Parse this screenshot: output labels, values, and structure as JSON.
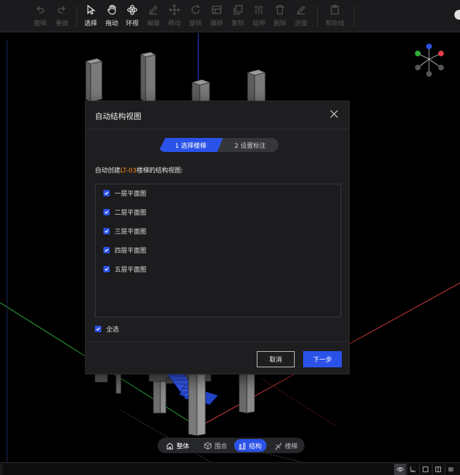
{
  "toolbar": {
    "undo": "撤销",
    "redo": "重做",
    "select": "选择",
    "drag": "拖动",
    "orbit": "环视",
    "edit": "编辑",
    "move": "移动",
    "rotate": "旋转",
    "shift": "偏移",
    "copy": "复制",
    "extend": "延伸",
    "delete": "删除",
    "measure": "测量",
    "help": "帮助线"
  },
  "dialog": {
    "title": "自动结构视图",
    "step1": "1 选择楼梯",
    "step2": "2 设置标注",
    "prompt_prefix": "自动创建",
    "prompt_highlight": "LT-03",
    "prompt_suffix": "楼梯的结构视图:",
    "items": [
      {
        "label": "一层平面图",
        "checked": true
      },
      {
        "label": "二层平面图",
        "checked": true
      },
      {
        "label": "三层平面图",
        "checked": true
      },
      {
        "label": "四层平面图",
        "checked": true
      },
      {
        "label": "五层平面图",
        "checked": true
      }
    ],
    "select_all": "全选",
    "cancel": "取消",
    "next": "下一步"
  },
  "modes": {
    "whole": "整体",
    "enclose": "围合",
    "structure": "结构",
    "stairs": "楼梯",
    "active": "structure"
  },
  "colors": {
    "accent": "#2b52e8",
    "highlight": "#ff8a1c",
    "axis_x": "#d23a3a",
    "axis_y": "#2fae3a",
    "axis_z": "#2b52e8"
  }
}
